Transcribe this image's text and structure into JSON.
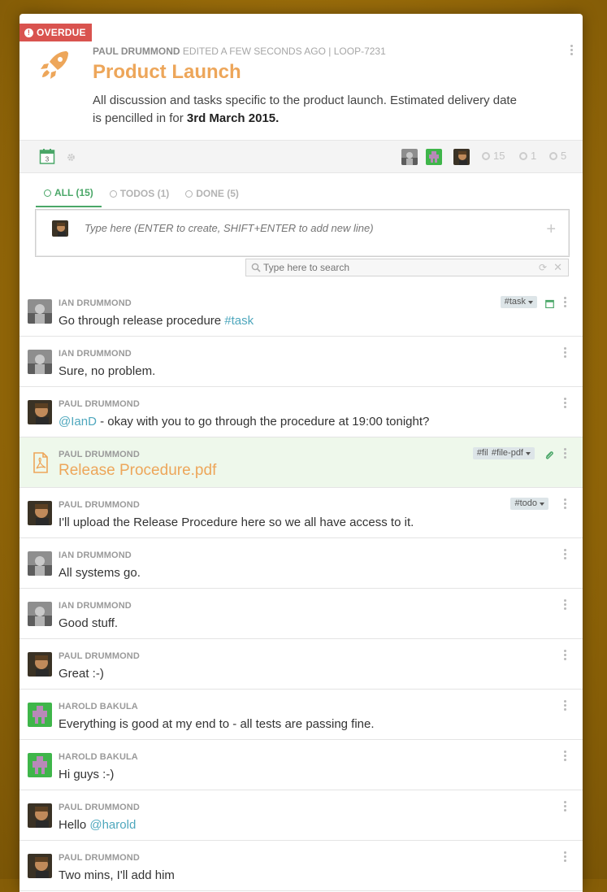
{
  "overdue_label": "OVERDUE",
  "loop": {
    "author": "PAUL DRUMMOND",
    "edited": "EDITED A FEW SECONDS AGO | LOOP-7231",
    "title": "Product Launch",
    "description_pre": "All discussion and tasks specific to the product launch. Estimated delivery date is pencilled in for ",
    "description_bold": "3rd March 2015."
  },
  "toolbar": {
    "calendar_day": "3",
    "stats": {
      "total": "15",
      "todos": "1",
      "done": "5"
    }
  },
  "tabs": [
    {
      "label": "ALL (15)",
      "active": true
    },
    {
      "label": "TODOS (1)",
      "active": false
    },
    {
      "label": "DONE (5)",
      "active": false
    }
  ],
  "composer": {
    "placeholder": "Type here (ENTER to create, SHIFT+ENTER to add new line)",
    "plus": "+"
  },
  "search": {
    "placeholder": "Type here to search",
    "clear": "✕",
    "refresh": "⟳"
  },
  "feed": [
    {
      "author": "IAN DRUMMOND",
      "text": "Go through release procedure ",
      "link": "#task"
    },
    {
      "author": "IAN DRUMMOND",
      "text": "Sure, no problem."
    },
    {
      "author": "PAUL DRUMMOND",
      "link_pre": "@IanD",
      "text": " - okay with you to go through the procedure at 19:00 tonight?"
    },
    {
      "author": "PAUL DRUMMOND",
      "text": "Release Procedure.pdf"
    },
    {
      "author": "PAUL DRUMMOND",
      "text": "I'll upload the Release Procedure here so we all have access to it."
    },
    {
      "author": "IAN DRUMMOND",
      "text": "All systems go."
    },
    {
      "author": "IAN DRUMMOND",
      "text": "Good stuff."
    },
    {
      "author": "PAUL DRUMMOND",
      "text": "Great :-)"
    },
    {
      "author": "HAROLD BAKULA",
      "text": "Everything is good at my end to - all tests are passing fine."
    },
    {
      "author": "HAROLD BAKULA",
      "text": "Hi guys :-)"
    },
    {
      "author": "PAUL DRUMMOND",
      "text": "Hello ",
      "link": "@harold"
    },
    {
      "author": "PAUL DRUMMOND",
      "text": "Two mins, I'll add him"
    }
  ],
  "tags": {
    "task": "#task",
    "file": "#file",
    "file_pdf": "#file-pdf",
    "todo": "#todo"
  },
  "colors": {
    "accent_orange": "#eda65a",
    "accent_green": "#4aa768",
    "link_blue": "#4ea7bd",
    "overdue_red": "#d9534f",
    "file_row_bg": "#eef8eb"
  }
}
